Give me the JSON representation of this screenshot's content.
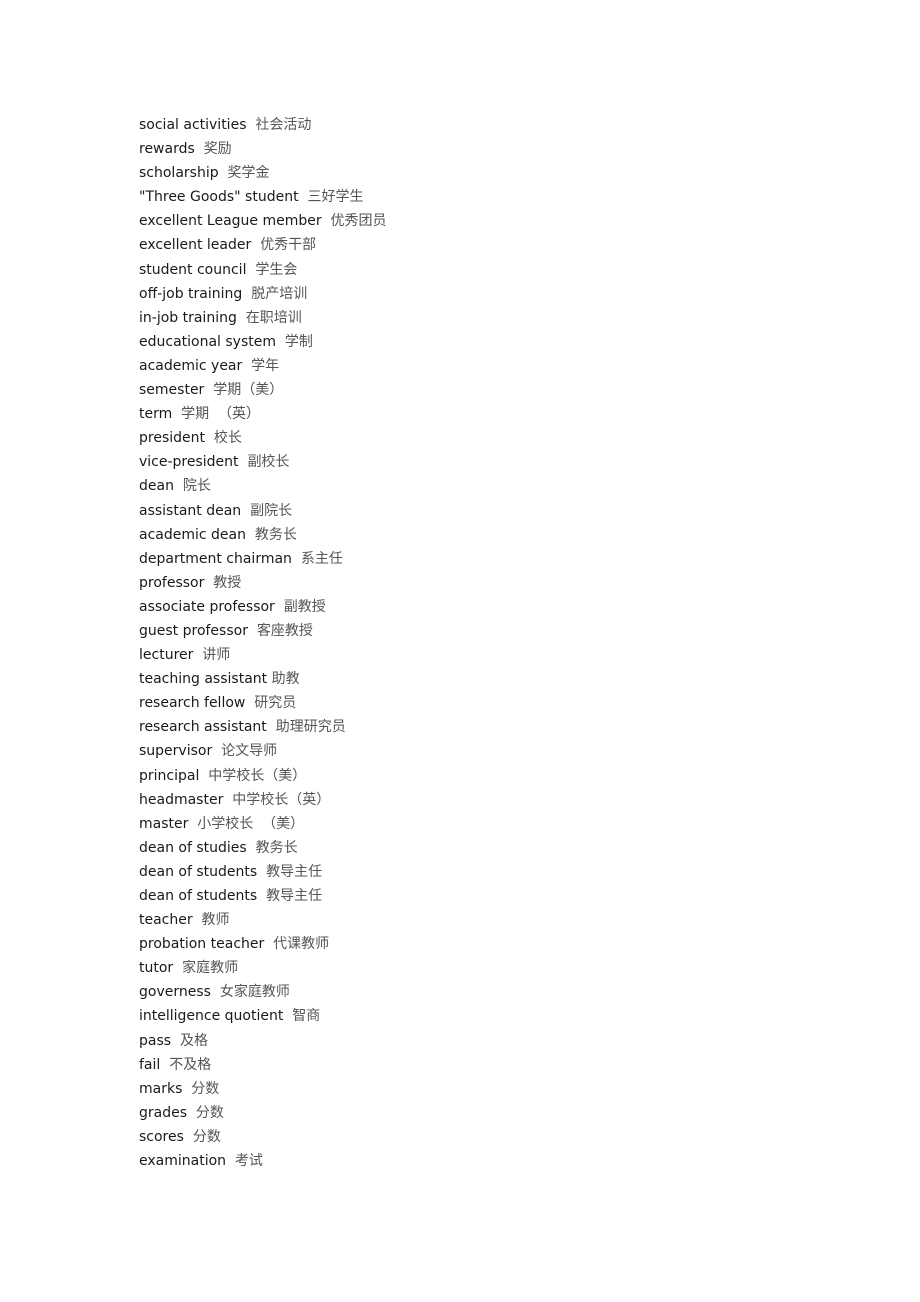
{
  "entries": [
    {
      "en": "social activities",
      "sep": "  ",
      "zh": "社会活动"
    },
    {
      "en": "rewards",
      "sep": "  ",
      "zh": "奖励"
    },
    {
      "en": "scholarship",
      "sep": "  ",
      "zh": "奖学金"
    },
    {
      "en": "\"Three Goods\" student",
      "sep": "  ",
      "zh": "三好学生"
    },
    {
      "en": "excellent League member",
      "sep": "  ",
      "zh": "优秀团员"
    },
    {
      "en": "excellent leader",
      "sep": "  ",
      "zh": "优秀干部"
    },
    {
      "en": "student council",
      "sep": "  ",
      "zh": "学生会"
    },
    {
      "en": "off-job training",
      "sep": "  ",
      "zh": "脱产培训"
    },
    {
      "en": "in-job training",
      "sep": "  ",
      "zh": "在职培训"
    },
    {
      "en": "educational system",
      "sep": "  ",
      "zh": "学制"
    },
    {
      "en": "academic year",
      "sep": "  ",
      "zh": "学年"
    },
    {
      "en": "semester",
      "sep": "  ",
      "zh": "学期（美）"
    },
    {
      "en": "term",
      "sep": "  ",
      "zh": "学期  （英）"
    },
    {
      "en": "president",
      "sep": "  ",
      "zh": "校长"
    },
    {
      "en": "vice-president",
      "sep": "  ",
      "zh": "副校长"
    },
    {
      "en": "dean",
      "sep": "  ",
      "zh": "院长"
    },
    {
      "en": "assistant dean",
      "sep": "  ",
      "zh": "副院长"
    },
    {
      "en": "academic dean",
      "sep": "  ",
      "zh": "教务长"
    },
    {
      "en": "department chairman",
      "sep": "  ",
      "zh": "系主任"
    },
    {
      "en": "professor",
      "sep": "  ",
      "zh": "教授"
    },
    {
      "en": "associate professor",
      "sep": "  ",
      "zh": "副教授"
    },
    {
      "en": "guest professor",
      "sep": "  ",
      "zh": "客座教授"
    },
    {
      "en": "lecturer",
      "sep": "  ",
      "zh": "讲师"
    },
    {
      "en": "teaching assistant",
      "sep": " ",
      "zh": "助教"
    },
    {
      "en": "research fellow",
      "sep": "  ",
      "zh": "研究员"
    },
    {
      "en": "research assistant",
      "sep": "  ",
      "zh": "助理研究员"
    },
    {
      "en": "supervisor",
      "sep": "  ",
      "zh": "论文导师"
    },
    {
      "en": "principal",
      "sep": "  ",
      "zh": "中学校长（美）"
    },
    {
      "en": "headmaster",
      "sep": "  ",
      "zh": "中学校长（英）"
    },
    {
      "en": "master",
      "sep": "  ",
      "zh": "小学校长  （美）"
    },
    {
      "en": "dean of studies",
      "sep": "  ",
      "zh": "教务长"
    },
    {
      "en": "dean of students",
      "sep": "  ",
      "zh": "教导主任"
    },
    {
      "en": "dean of students",
      "sep": "  ",
      "zh": "教导主任"
    },
    {
      "en": "teacher",
      "sep": "  ",
      "zh": "教师"
    },
    {
      "en": "probation teacher",
      "sep": "  ",
      "zh": "代课教师"
    },
    {
      "en": "tutor",
      "sep": "  ",
      "zh": "家庭教师"
    },
    {
      "en": "governess",
      "sep": "  ",
      "zh": "女家庭教师"
    },
    {
      "en": "intelligence quotient",
      "sep": "  ",
      "zh": "智商"
    },
    {
      "en": "pass",
      "sep": "  ",
      "zh": "及格"
    },
    {
      "en": "fail",
      "sep": "  ",
      "zh": "不及格"
    },
    {
      "en": "marks",
      "sep": "  ",
      "zh": "分数"
    },
    {
      "en": "grades",
      "sep": "  ",
      "zh": "分数"
    },
    {
      "en": "scores",
      "sep": "  ",
      "zh": "分数"
    },
    {
      "en": "examination",
      "sep": "  ",
      "zh": "考试"
    }
  ]
}
